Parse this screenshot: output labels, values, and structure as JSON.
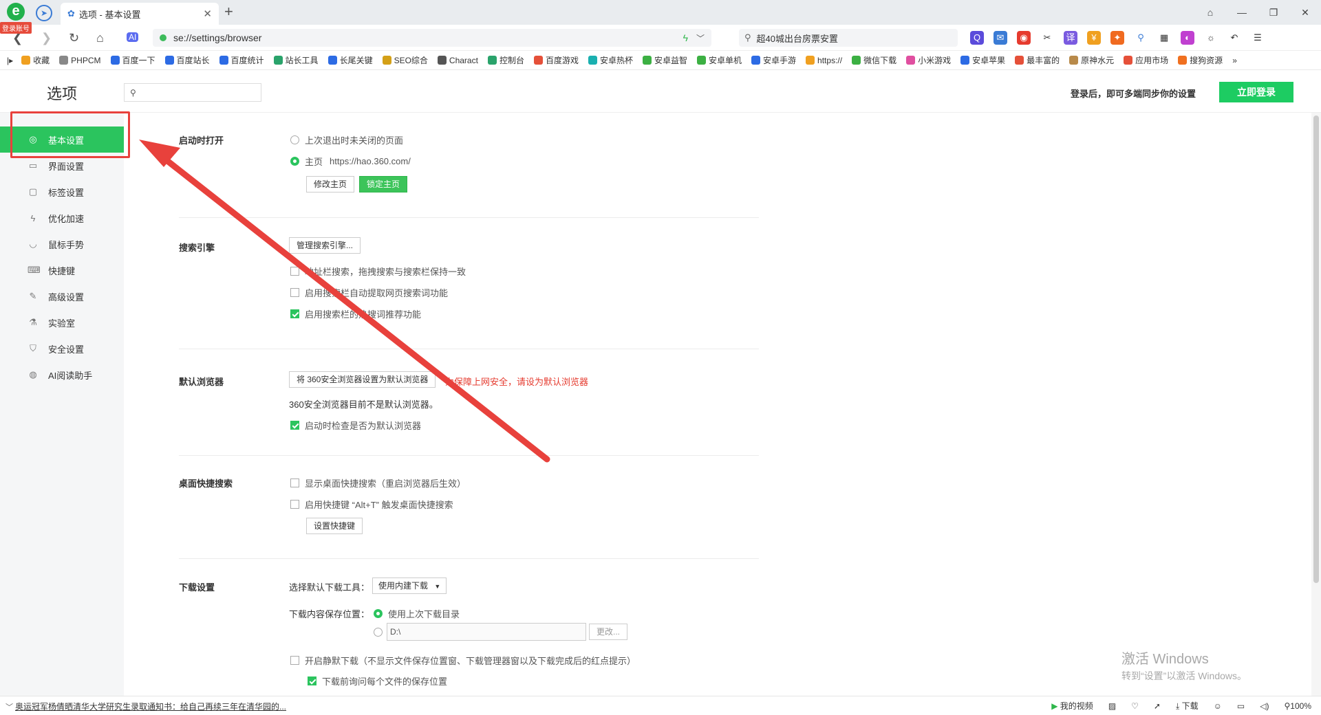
{
  "browser": {
    "login_badge": "登录账号",
    "tab_title": "选项 - 基本设置",
    "url": "se://settings/browser",
    "search_query": "超40城出台房票安置"
  },
  "bookmarks": [
    {
      "label": "收藏",
      "color": "#f0a020"
    },
    {
      "label": "PHPCM",
      "color": "#888888"
    },
    {
      "label": "百度一下",
      "color": "#2d6be4"
    },
    {
      "label": "百度站长",
      "color": "#2d6be4"
    },
    {
      "label": "百度统计",
      "color": "#2d6be4"
    },
    {
      "label": "站长工具",
      "color": "#2aa36b"
    },
    {
      "label": "长尾关键",
      "color": "#2d6be4"
    },
    {
      "label": "SEO综合",
      "color": "#d4a017"
    },
    {
      "label": "Charact",
      "color": "#555555"
    },
    {
      "label": "控制台",
      "color": "#2aa36b"
    },
    {
      "label": "百度游戏",
      "color": "#e55039"
    },
    {
      "label": "安卓热杯",
      "color": "#1ab0b0"
    },
    {
      "label": "安卓益智",
      "color": "#3cb043"
    },
    {
      "label": "安卓单机",
      "color": "#3cb043"
    },
    {
      "label": "安卓手游",
      "color": "#2d6be4"
    },
    {
      "label": "https://",
      "color": "#f0a020"
    },
    {
      "label": "微信下载",
      "color": "#3cb043"
    },
    {
      "label": "小米游戏",
      "color": "#e04fa0"
    },
    {
      "label": "安卓苹果",
      "color": "#2d6be4"
    },
    {
      "label": "最丰富的",
      "color": "#e55039"
    },
    {
      "label": "原神水元",
      "color": "#b88a4a"
    },
    {
      "label": "应用市场",
      "color": "#e55039"
    },
    {
      "label": "搜狗资源",
      "color": "#f07020"
    }
  ],
  "settings": {
    "page_title": "选项",
    "sync_text": "登录后，即可多端同步你的设置",
    "login_button": "立即登录"
  },
  "sidebar": [
    {
      "label": "基本设置",
      "icon": "target-icon",
      "glyph": "◎",
      "active": true
    },
    {
      "label": "界面设置",
      "icon": "window-icon",
      "glyph": "▭",
      "active": false
    },
    {
      "label": "标签设置",
      "icon": "tab-icon",
      "glyph": "▢",
      "active": false
    },
    {
      "label": "优化加速",
      "icon": "lightning-icon",
      "glyph": "ϟ",
      "active": false
    },
    {
      "label": "鼠标手势",
      "icon": "mouse-icon",
      "glyph": "◡",
      "active": false
    },
    {
      "label": "快捷键",
      "icon": "keyboard-icon",
      "glyph": "⌨",
      "active": false
    },
    {
      "label": "高级设置",
      "icon": "wrench-icon",
      "glyph": "✎",
      "active": false
    },
    {
      "label": "实验室",
      "icon": "flask-icon",
      "glyph": "⚗",
      "active": false
    },
    {
      "label": "安全设置",
      "icon": "shield-icon",
      "glyph": "⛉",
      "active": false
    },
    {
      "label": "AI阅读助手",
      "icon": "ai-icon",
      "glyph": "◍",
      "active": false
    }
  ],
  "startup": {
    "title": "启动时打开",
    "opt_restore": "上次退出时未关闭的页面",
    "opt_homepage": "主页",
    "homepage_url": "https://hao.360.com/",
    "btn_modify": "修改主页",
    "btn_lock": "锁定主页"
  },
  "search_engine": {
    "title": "搜索引擎",
    "btn_manage": "管理搜索引擎...",
    "opt1": "地址栏搜索，拖拽搜索与搜索栏保持一致",
    "opt2": "启用搜索栏自动提取网页搜索词功能",
    "opt3": "启用搜索栏的热搜词推荐功能"
  },
  "default_browser": {
    "title": "默认浏览器",
    "btn_set": "将 360安全浏览器设置为默认浏览器",
    "warning": "为保障上网安全，请设为默认浏览器",
    "status": "360安全浏览器目前不是默认浏览器。",
    "opt_check": "启动时检查是否为默认浏览器"
  },
  "desktop_search": {
    "title": "桌面快捷搜索",
    "opt1": "显示桌面快捷搜索（重启浏览器后生效）",
    "opt2": "启用快捷键 “Alt+T” 触发桌面快捷搜索",
    "btn_hotkey": "设置快捷键"
  },
  "download": {
    "title": "下载设置",
    "tool_label": "选择默认下载工具：",
    "tool_value": "使用内建下载",
    "location_label": "下载内容保存位置：",
    "opt_last_dir": "使用上次下载目录",
    "path_value": "D:\\",
    "btn_change": "更改...",
    "opt_silent": "开启静默下载（不显示文件保存位置窗、下载管理器窗以及下载完成后的红点提示）",
    "opt_ask": "下载前询问每个文件的保存位置"
  },
  "watermark": {
    "line1": "激活 Windows",
    "line2": "转到“设置”以激活 Windows。"
  },
  "statusbar": {
    "news": "奥运冠军杨倩晒清华大学研究生录取通知书：给自己再续三年在清华园的...",
    "video": "我的视频",
    "download": "下载",
    "zoom": "100%"
  }
}
